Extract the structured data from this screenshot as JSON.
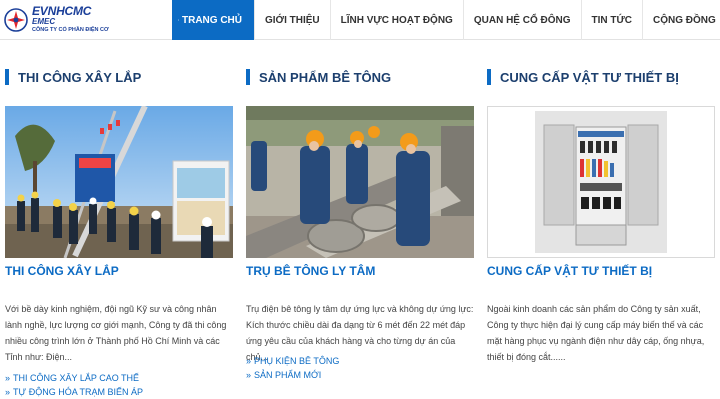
{
  "brand": {
    "line1": "EVNHCMC",
    "line2": "EMEC",
    "line3": "CÔNG TY CỔ PHẦN ĐIỆN CƠ",
    "accent": "#0c6bc4",
    "navy": "#1c3f6e"
  },
  "nav": [
    {
      "label": "TRANG CHỦ",
      "active": true,
      "icon": "home-icon"
    },
    {
      "label": "GIỚI THIỆU",
      "active": false
    },
    {
      "label": "LĨNH VỰC HOẠT ĐỘNG",
      "active": false
    },
    {
      "label": "QUAN HỆ CỔ ĐÔNG",
      "active": false
    },
    {
      "label": "TIN TỨC",
      "active": false
    },
    {
      "label": "CỘNG ĐỒNG",
      "active": false
    }
  ],
  "sections": [
    {
      "heading": "THI CÔNG XÂY LẮP",
      "item_title": "THI CÔNG XÂY LẮP",
      "description": "Với bề dày kinh nghiệm, đội ngũ Kỹ sư và công nhân lành nghề, lực lượng cơ giới mạnh, Công ty đã thi công nhiều công trình lớn ở Thành phố Hồ Chí Minh và các Tỉnh như: Điện...",
      "links": [
        "THI CÔNG XÂY LẮP CAO THẾ",
        "TỰ ĐỘNG HÓA TRẠM BIẾN ÁP"
      ]
    },
    {
      "heading": "SẢN PHẨM BÊ TÔNG",
      "item_title": "TRỤ BÊ TÔNG LY TÂM",
      "description": "Trụ điện bê tông ly tâm dự ứng lực và không dự ứng lực: Kích thước chiều dài đa dạng từ 6 mét đến 22 mét đáp ứng yêu cầu của khách hàng và cho từng dự án của chủ...",
      "links": [
        "PHỤ KIỆN BÊ TÔNG",
        "SẢN PHẨM MỚI"
      ]
    },
    {
      "heading": "CUNG CẤP VẬT TƯ THIẾT BỊ",
      "item_title": "CUNG CẤP VẬT TƯ THIẾT BỊ",
      "description": "Ngoài kinh doanh các sản phẩm do Công ty sản xuất, Công ty thực hiện đại lý cung cấp máy biến thế và các mặt hàng phục vụ ngành điện như dây cáp, ống nhựa, thiết bị đóng cắt......",
      "links": []
    }
  ]
}
